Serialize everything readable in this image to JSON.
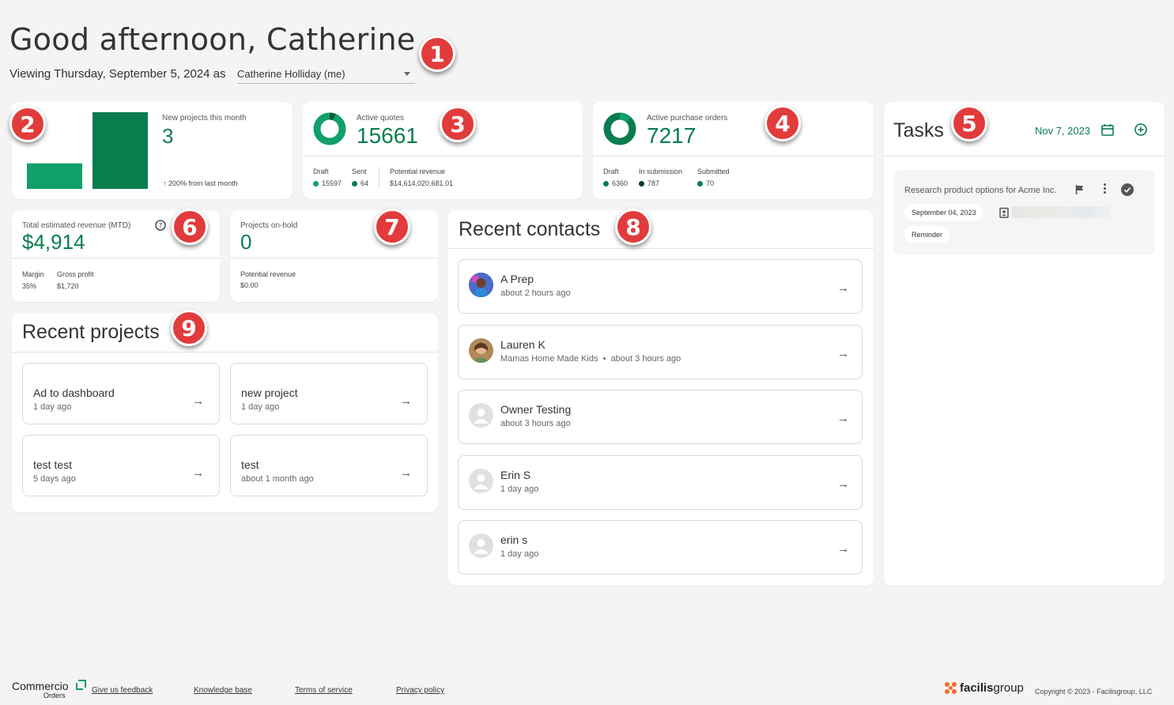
{
  "header": {
    "greeting": "Good afternoon, Catherine",
    "viewing_prefix": "Viewing Thursday, September 5, 2024 as",
    "user_select": "Catherine Holliday (me)"
  },
  "new_projects": {
    "label": "New projects this month",
    "value": "3",
    "change": "200% from last month",
    "bar_values": [
      1,
      3
    ]
  },
  "active_quotes": {
    "label": "Active quotes",
    "value": "15661",
    "draft_label": "Draft",
    "draft_value": "15597",
    "sent_label": "Sent",
    "sent_value": "64",
    "revenue_label": "Potential revenue",
    "revenue_value": "$14,614,020,681.01",
    "ring_fraction": 0.06
  },
  "active_pos": {
    "label": "Active purchase orders",
    "value": "7217",
    "draft_label": "Draft",
    "draft_value": "6360",
    "insub_label": "In submission",
    "insub_value": "787",
    "submitted_label": "Submitted",
    "submitted_value": "70",
    "ring_fraction": 0.12
  },
  "tasks": {
    "title": "Tasks",
    "date": "Nov 7, 2023",
    "items": [
      {
        "title": "Research product options for Acme Inc.",
        "due": "September 04, 2023",
        "tag": "Reminder"
      }
    ]
  },
  "revenue": {
    "label": "Total estimated revenue (MTD)",
    "value": "$4,914",
    "margin_label": "Margin",
    "margin_value": "35%",
    "gross_label": "Gross profit",
    "gross_value": "$1,720"
  },
  "onhold": {
    "label": "Projects on-hold",
    "value": "0",
    "revenue_label": "Potential revenue",
    "revenue_value": "$0.00"
  },
  "recent_contacts": {
    "title": "Recent contacts",
    "items": [
      {
        "name": "A Prep",
        "sub": "about 2 hours ago"
      },
      {
        "name": "Lauren K",
        "sub": "Mamas Home Made Kids  •  about 3 hours ago"
      },
      {
        "name": "Owner Testing",
        "sub": "about 3 hours ago"
      },
      {
        "name": "Erin S",
        "sub": "1 day ago"
      },
      {
        "name": "erin s",
        "sub": "1 day ago"
      }
    ]
  },
  "recent_projects": {
    "title": "Recent projects",
    "items": [
      {
        "name": "Ad to dashboard",
        "sub": "1 day ago"
      },
      {
        "name": "new project",
        "sub": "1 day ago"
      },
      {
        "name": "test test",
        "sub": "5 days ago"
      },
      {
        "name": "test",
        "sub": "about 1 month ago"
      }
    ]
  },
  "badges": [
    "1",
    "2",
    "3",
    "4",
    "5",
    "6",
    "7",
    "8",
    "9"
  ],
  "footer": {
    "logo_main": "Commercio",
    "logo_sub": "Orders",
    "links": [
      "Give us feedback",
      "Knowledge base",
      "Terms of service",
      "Privacy policy"
    ],
    "brand_a": "facilis",
    "brand_b": "group",
    "copyright": "Copyright © 2023 - Facilisgroup, LLC"
  },
  "colors": {
    "accent": "#0a7d4f",
    "accent_light": "#10a06a",
    "badge": "#e23b3b"
  }
}
